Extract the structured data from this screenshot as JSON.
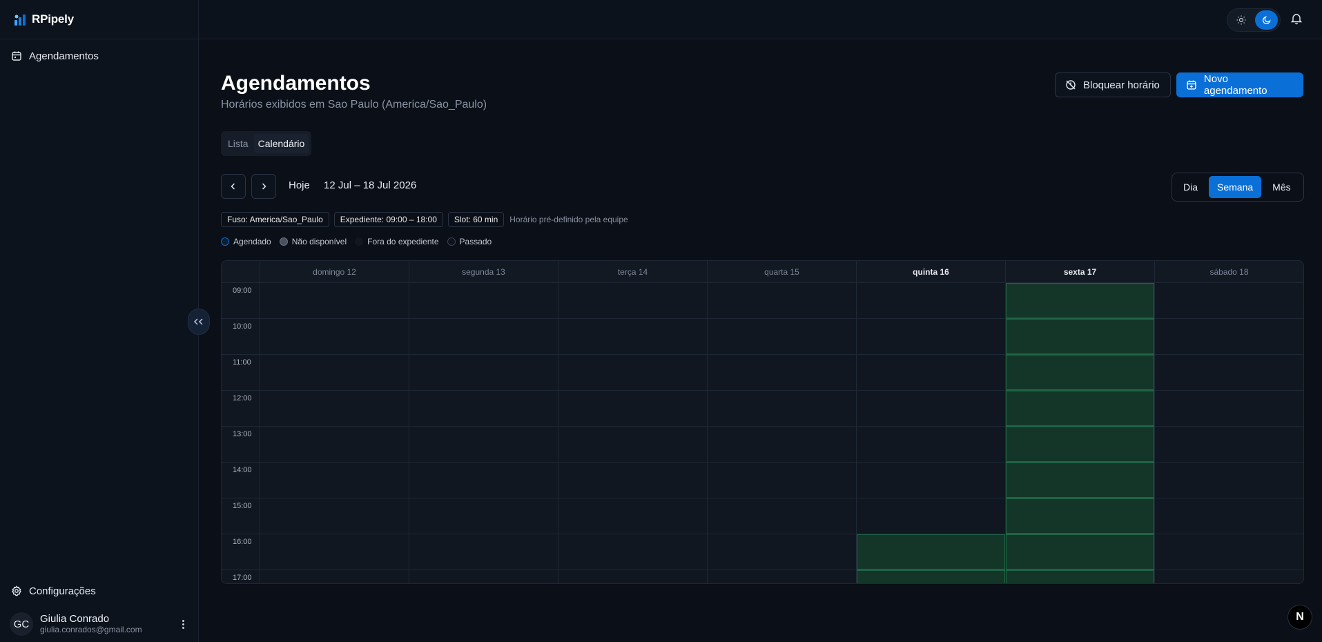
{
  "app": {
    "brand": "RPipely"
  },
  "sidebar": {
    "nav_item": "Agendamentos",
    "settings": "Configurações",
    "user": {
      "initials": "GC",
      "name": "Giulia Conrado",
      "email": "giulia.conrados@gmail.com"
    }
  },
  "header": {
    "title": "Agendamentos",
    "subtitle": "Horários exibidos em Sao Paulo (America/Sao_Paulo)",
    "block_button": "Bloquear horário",
    "new_button": "Novo agendamento"
  },
  "view_tabs": [
    {
      "label": "Lista",
      "active": false
    },
    {
      "label": "Calendário",
      "active": true
    }
  ],
  "toolbar": {
    "today": "Hoje",
    "range": "12 Jul – 18 Jul 2026",
    "modes": [
      {
        "label": "Dia",
        "active": false
      },
      {
        "label": "Semana",
        "active": true
      },
      {
        "label": "Mês",
        "active": false
      }
    ]
  },
  "chips": {
    "timezone": "Fuso: America/Sao_Paulo",
    "hours": "Expediente: 09:00 – 18:00",
    "slot": "Slot: 60 min",
    "note": "Horário pré-definido pela equipe"
  },
  "legend": [
    {
      "label": "Agendado",
      "color": "#0b6fd8"
    },
    {
      "label": "Não disponível",
      "color": "#4a515e"
    },
    {
      "label": "Fora do expediente",
      "color": "#111720"
    },
    {
      "label": "Passado",
      "color": "#1a212c"
    }
  ],
  "calendar": {
    "days": [
      {
        "label": "domingo 12",
        "strong": false,
        "busy": []
      },
      {
        "label": "segunda 13",
        "strong": false,
        "busy": []
      },
      {
        "label": "terça 14",
        "strong": false,
        "busy": []
      },
      {
        "label": "quarta 15",
        "strong": false,
        "busy": []
      },
      {
        "label": "quinta 16",
        "strong": true,
        "busy": [
          "16:00",
          "17:00"
        ]
      },
      {
        "label": "sexta 17",
        "strong": true,
        "busy": [
          "09:00",
          "10:00",
          "11:00",
          "12:00",
          "13:00",
          "14:00",
          "15:00",
          "16:00",
          "17:00"
        ]
      },
      {
        "label": "sábado 18",
        "strong": false,
        "busy": []
      }
    ],
    "hours": [
      "09:00",
      "10:00",
      "11:00",
      "12:00",
      "13:00",
      "14:00",
      "15:00",
      "16:00",
      "17:00"
    ]
  },
  "fab": "N",
  "colors": {
    "primary": "#0b6fd8",
    "busy": "#143629",
    "background": "#0b0f17"
  }
}
